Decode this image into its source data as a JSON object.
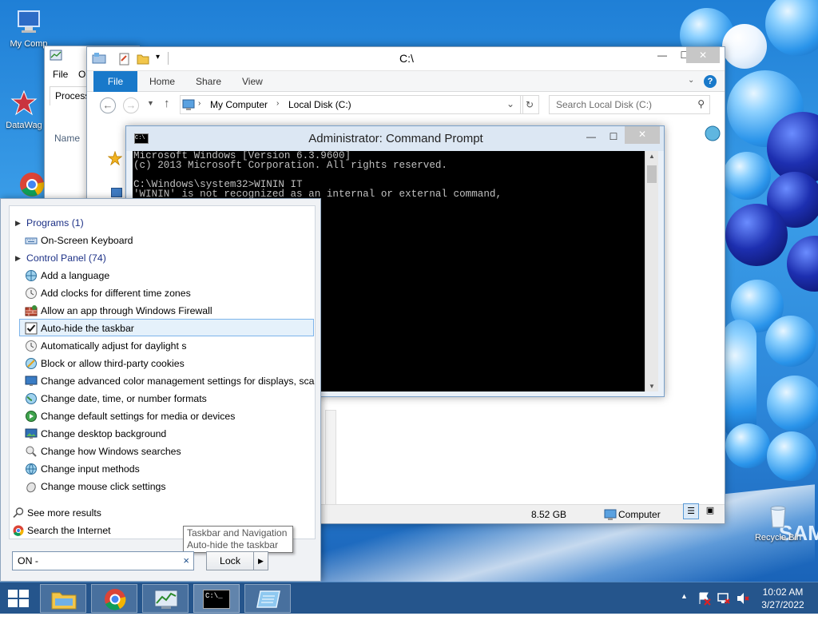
{
  "desktop": {
    "icons": [
      {
        "label": "My Comp"
      },
      {
        "label": "DataWag"
      },
      {
        "label": "Recycle Bin"
      }
    ],
    "wallpaper_text": "SAM"
  },
  "taskmgr": {
    "menu": [
      "File",
      "O"
    ],
    "tab": "Process",
    "column": "Name"
  },
  "explorer": {
    "title": "C:\\",
    "ribbon_tabs": {
      "file": "File",
      "home": "Home",
      "share": "Share",
      "view": "View"
    },
    "breadcrumb": [
      "My Computer",
      "Local Disk (C:)"
    ],
    "search_placeholder": "Search Local Disk (C:)",
    "status": {
      "size": "8.52 GB",
      "location": "Computer"
    }
  },
  "cmd": {
    "title": "Administrator: Command Prompt",
    "lines": [
      "Microsoft Windows [Version 6.3.9600]",
      "(c) 2013 Microsoft Corporation. All rights reserved.",
      "",
      "C:\\Windows\\system32>WININ IT",
      "'WININ' is not recognized as an internal or external command,"
    ]
  },
  "search_panel": {
    "groups": {
      "programs": "Programs (1)",
      "control_panel": "Control Panel (74)"
    },
    "program_items": [
      "On-Screen Keyboard"
    ],
    "control_items": [
      "Add a language",
      "Add clocks for different time zones",
      "Allow an app through Windows Firewall",
      "Auto-hide the taskbar",
      "Automatically adjust for daylight s",
      "Block or allow third-party cookies",
      "Change advanced color management settings for displays, sca...",
      "Change date, time, or number formats",
      "Change default settings for media or devices",
      "Change desktop background",
      "Change how Windows searches",
      "Change input methods",
      "Change mouse click settings"
    ],
    "selected_index": 3,
    "tooltip": {
      "line1": "Taskbar and Navigation",
      "line2": "Auto-hide the taskbar"
    },
    "see_more": "See more results",
    "search_internet": "Search the Internet",
    "query": "ON -",
    "clear_symbol": "×",
    "power_button": "Lock"
  },
  "taskbar": {
    "clock_time": "10:02 AM",
    "clock_date": "3/27/2022"
  },
  "colors": {
    "accent_blue": "#1979ca",
    "group_header": "#1e3287",
    "selection_bg": "#e5f1fb"
  }
}
